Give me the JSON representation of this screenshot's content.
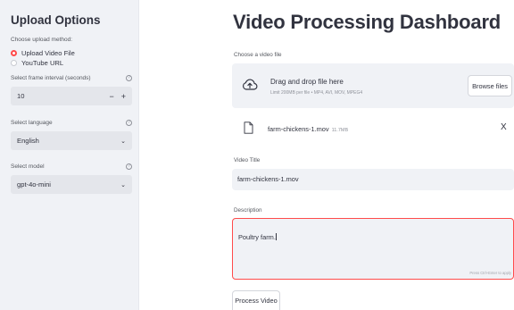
{
  "sidebar": {
    "title": "Upload Options",
    "upload_method_label": "Choose upload method:",
    "upload_methods": [
      {
        "label": "Upload Video File",
        "selected": true
      },
      {
        "label": "YouTube URL",
        "selected": false
      }
    ],
    "interval_label": "Select frame interval (seconds)",
    "interval_value": "10",
    "stepper_minus": "−",
    "stepper_plus": "+",
    "language_label": "Select language",
    "language_value": "English",
    "model_label": "Select model",
    "model_value": "gpt-4o-mini",
    "help_glyph": "?",
    "chevron_glyph": "⌄"
  },
  "main": {
    "title": "Video Processing Dashboard",
    "file_label": "Choose a video file",
    "dropzone": {
      "main_text": "Drag and drop file here",
      "sub_text": "Limit 200MB per file • MP4, AVI, MOV, MPEG4",
      "browse_label": "Browse files"
    },
    "uploaded_file": {
      "name": "farm-chickens-1.mov",
      "size": "11.7MB",
      "remove_glyph": "X"
    },
    "video_title_label": "Video Title",
    "video_title_value": "farm-chickens-1.mov",
    "description_label": "Description",
    "description_value": "Poultry farm.",
    "description_hint": "Press Ctrl+Enter to apply",
    "process_label": "Process Video"
  },
  "colors": {
    "accent": "#ff4b4b",
    "sidebar_bg": "#f0f2f6",
    "text": "#31333f"
  }
}
